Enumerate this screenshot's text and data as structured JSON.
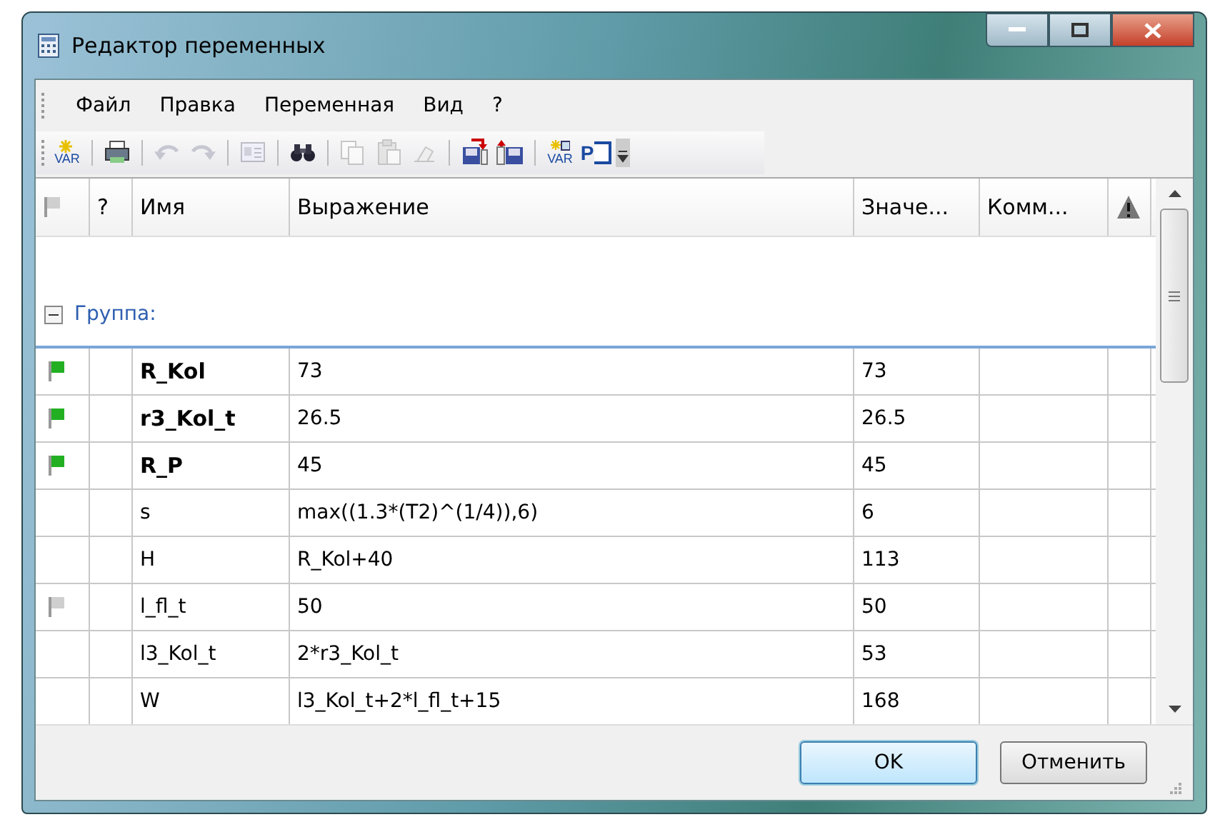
{
  "window": {
    "title": "Редактор переменных"
  },
  "menu": [
    {
      "label": "Файл"
    },
    {
      "label": "Правка"
    },
    {
      "label": "Переменная"
    },
    {
      "label": "Вид"
    },
    {
      "label": "?"
    }
  ],
  "toolbar": [
    {
      "kind": "var",
      "label": "VAR"
    },
    {
      "kind": "sep"
    },
    {
      "kind": "print"
    },
    {
      "kind": "sep"
    },
    {
      "kind": "undo",
      "disabled": true
    },
    {
      "kind": "redo",
      "disabled": true
    },
    {
      "kind": "sep"
    },
    {
      "kind": "form",
      "disabled": true
    },
    {
      "kind": "sep"
    },
    {
      "kind": "find"
    },
    {
      "kind": "sep"
    },
    {
      "kind": "copy",
      "disabled": true
    },
    {
      "kind": "paste",
      "disabled": true
    },
    {
      "kind": "clear",
      "disabled": true
    },
    {
      "kind": "sep"
    },
    {
      "kind": "save-down"
    },
    {
      "kind": "save-up"
    },
    {
      "kind": "sep"
    },
    {
      "kind": "var-table",
      "label": "VAR"
    },
    {
      "kind": "param",
      "label": "P"
    },
    {
      "kind": "more"
    }
  ],
  "table": {
    "columns": [
      {
        "kind": "flag"
      },
      {
        "kind": "text",
        "label": "?"
      },
      {
        "kind": "text",
        "label": "Имя"
      },
      {
        "kind": "text",
        "label": "Выражение"
      },
      {
        "kind": "text",
        "label": "Значе..."
      },
      {
        "kind": "text",
        "label": "Комм..."
      },
      {
        "kind": "warning"
      }
    ],
    "group": {
      "label": "Группа:",
      "expanded": true
    },
    "rows": [
      {
        "color": "#22b022",
        "bold": true,
        "name": "R_Kol",
        "expression": "73",
        "value": "73"
      },
      {
        "color": "#22b022",
        "bold": true,
        "name": "r3_Kol_t",
        "expression": "26.5",
        "value": "26.5"
      },
      {
        "color": "#22b022",
        "bold": true,
        "name": "R_P",
        "expression": "45",
        "value": "45"
      },
      {
        "bold": false,
        "name": "s",
        "expression": "max((1.3*(T2)^(1/4)),6)",
        "value": "6"
      },
      {
        "bold": false,
        "name": "H",
        "expression": "R_Kol+40",
        "value": "113"
      },
      {
        "color": "#cfcfcf",
        "bold": false,
        "name": "l_fl_t",
        "expression": "50",
        "value": "50"
      },
      {
        "bold": false,
        "name": "l3_Kol_t",
        "expression": "2*r3_Kol_t",
        "value": "53"
      },
      {
        "bold": false,
        "name": "W",
        "expression": "l3_Kol_t+2*l_fl_t+15",
        "value": "168"
      }
    ]
  },
  "buttons": [
    {
      "label": "OK",
      "default": true
    },
    {
      "label": "Отменить",
      "default": false
    }
  ]
}
